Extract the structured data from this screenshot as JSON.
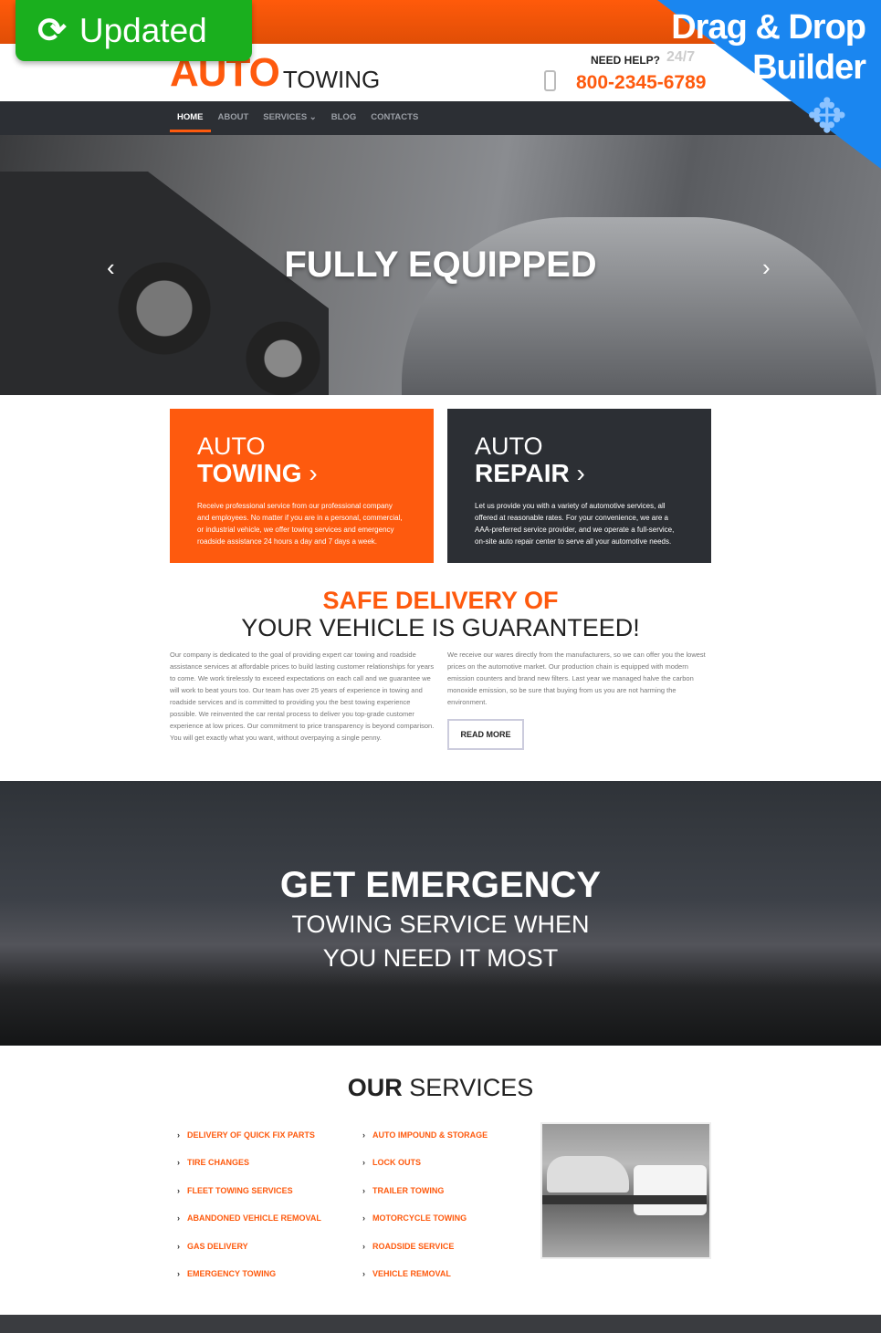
{
  "promo": {
    "updated": "Updated",
    "drag_drop_line1": "Drag & Drop",
    "drag_drop_line2": "Builder",
    "updated_icon": "refresh-icon",
    "builder_icon": "move-arrows-icon"
  },
  "header": {
    "logo_auto": "AUTO",
    "logo_towing": "TOWING",
    "need_help": "NEED HELP?",
    "hours": "24/7",
    "phone": "800-2345-6789"
  },
  "nav": {
    "items": [
      "HOME",
      "ABOUT",
      "SERVICES",
      "BLOG",
      "CONTACTS"
    ],
    "active": "HOME"
  },
  "hero": {
    "title": "FULLY EQUIPPED",
    "prev": "‹",
    "next": "›"
  },
  "boxes": [
    {
      "line1": "AUTO",
      "line2": "TOWING",
      "text": "Receive professional service from our professional company and employees. No matter if you are in a personal, commercial, or industrial vehicle, we offer towing services and emergency roadside assistance 24 hours a day and 7 days a week.",
      "color": "#fe5a0e"
    },
    {
      "line1": "AUTO",
      "line2": "REPAIR",
      "text": "Let us provide you with a variety of automotive services, all offered at reasonable rates. For your convenience, we are a AAA-preferred service provider, and we operate a full-service, on-site auto repair center to serve all your automotive needs.",
      "color": "#2c2f34"
    }
  ],
  "about": {
    "title_accent": "SAFE DELIVERY OF",
    "title_rest": "YOUR VEHICLE IS GUARANTEED!",
    "col1": "Our company is dedicated to the goal of providing expert car towing and roadside assistance services at affordable prices to build lasting customer relationships for years to come. We work tirelessly to exceed expectations on each call and we guarantee we will work to beat yours too. Our team has over 25 years of experience in towing and roadside services and is committed to providing you the best towing experience possible. We reinvented the car rental process to deliver you top-grade customer experience at low prices. Our commitment to price transparency is beyond comparison. You will get exactly what you want, without overpaying a single penny.",
    "col2": "We receive our wares directly from the manufacturers, so we can offer you the lowest prices on the automotive market. Our production chain is equipped with modern emission counters and brand new filters. Last year we managed halve the carbon monoxide emission, so be sure that buying from us you are not harming the environment.",
    "read_more": "READ MORE"
  },
  "emergency": {
    "title": "GET EMERGENCY",
    "line1": "TOWING SERVICE WHEN",
    "line2": "YOU NEED IT MOST"
  },
  "services": {
    "title_bold": "OUR",
    "title_rest": "SERVICES",
    "col1": [
      "DELIVERY OF QUICK FIX PARTS",
      "TIRE CHANGES",
      "FLEET TOWING SERVICES",
      "ABANDONED VEHICLE REMOVAL",
      "GAS DELIVERY",
      "EMERGENCY TOWING"
    ],
    "col2": [
      "AUTO IMPOUND & STORAGE",
      "LOCK OUTS",
      "TRAILER TOWING",
      "MOTORCYCLE TOWING",
      "ROADSIDE SERVICE",
      "VEHICLE REMOVAL"
    ]
  },
  "colors": {
    "accent": "#fe5a0e",
    "dark": "#2c2f34",
    "promo_green": "#1aaf1e",
    "promo_blue": "#1a86f0"
  }
}
